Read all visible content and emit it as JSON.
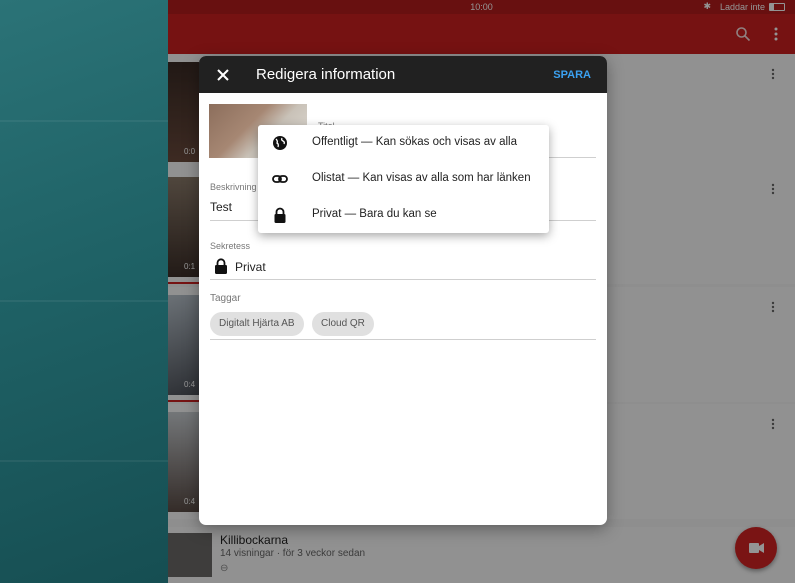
{
  "status_bar": {
    "time": "10:00",
    "battery_text": "Laddar inte"
  },
  "list": {
    "durations": [
      "0:0",
      "0:1",
      "0:4",
      "0:4"
    ],
    "last_video": {
      "title": "Killibockarna",
      "meta": "14 visningar · för 3 veckor sedan",
      "link_glyph": "⊖"
    }
  },
  "dialog": {
    "title": "Redigera information",
    "save_label": "SPARA",
    "title_field": {
      "label": "Titel",
      "value": ""
    },
    "description": {
      "label": "Beskrivning",
      "value": "Test"
    },
    "privacy": {
      "label": "Sekretess",
      "value": "Privat",
      "icon": "lock-icon"
    },
    "tags": {
      "label": "Taggar",
      "chips": [
        "Digitalt Hjärta AB",
        "Cloud QR"
      ]
    }
  },
  "privacy_menu": {
    "items": [
      {
        "icon": "globe-icon",
        "label": "Offentligt — Kan sökas och visas av alla"
      },
      {
        "icon": "link-icon",
        "label": "Olistat — Kan visas av alla som har länken"
      },
      {
        "icon": "lock-icon",
        "label": "Privat — Bara du kan se"
      }
    ]
  },
  "colors": {
    "app_bar": "#cc1f1f",
    "status_bar": "#b31d1d",
    "dialog_header": "#212121",
    "accent": "#3ba1f0",
    "fab": "#d32424"
  }
}
